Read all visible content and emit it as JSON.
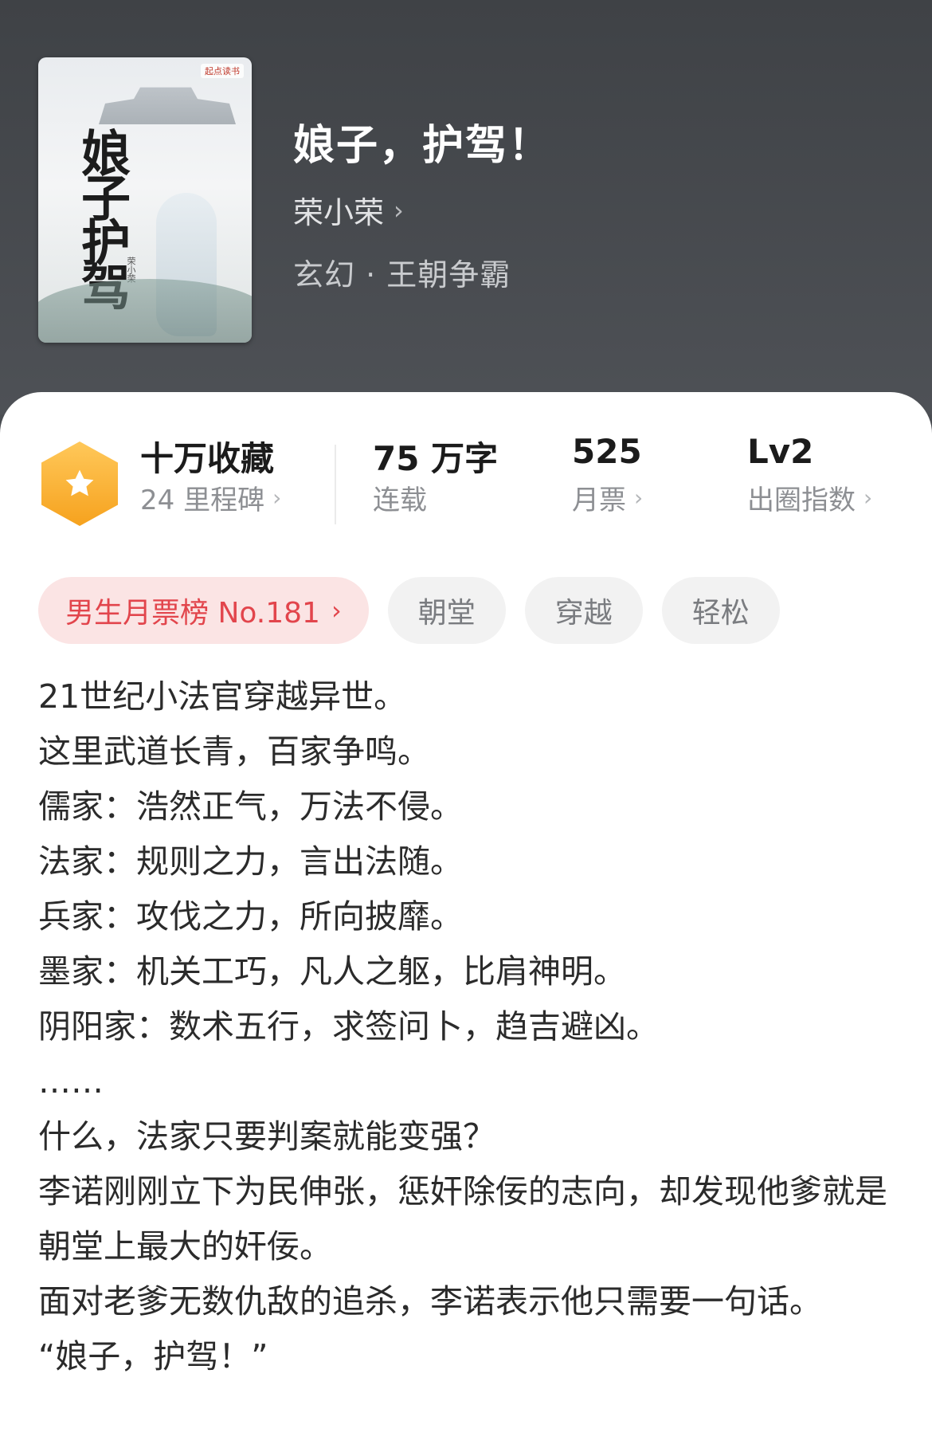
{
  "book": {
    "title": "娘子，护驾！",
    "author": "荣小荣",
    "genre": "玄幻 · 王朝争霸",
    "cover": {
      "title_art": "娘子护驾",
      "publisher_badge": "起点读书",
      "author_stamp": "荣小荣"
    }
  },
  "stats": {
    "collection": {
      "value": "十万收藏",
      "sub": "24 里程碑"
    },
    "words": {
      "value": "75 万字",
      "sub": "连载"
    },
    "monthly_tickets": {
      "value": "525",
      "sub": "月票"
    },
    "breakout_index": {
      "value": "Lv2",
      "sub": "出圈指数"
    }
  },
  "tags": {
    "rank": "男生月票榜 No.181",
    "items": [
      "朝堂",
      "穿越",
      "轻松"
    ]
  },
  "intro": {
    "lines": [
      "21世纪小法官穿越异世。",
      "这里武道长青，百家争鸣。",
      "儒家：浩然正气，万法不侵。",
      "法家：规则之力，言出法随。",
      "兵家：攻伐之力，所向披靡。",
      "墨家：机关工巧，凡人之躯，比肩神明。",
      "阴阳家：数术五行，求签问卜，趋吉避凶。",
      "……",
      "什么，法家只要判案就能变强？",
      "李诺刚刚立下为民伸张，惩奸除佞的志向，却发现他爹就是朝堂上最大的奸佞。",
      "面对老爹无数仇敌的追杀，李诺表示他只需要一句话。",
      "“娘子，护驾！”"
    ]
  },
  "colors": {
    "header_bg": "#4a4d52",
    "rank_text": "#e2454c",
    "rank_bg": "#fbe4e4",
    "badge_orange": "#f6a21e"
  }
}
